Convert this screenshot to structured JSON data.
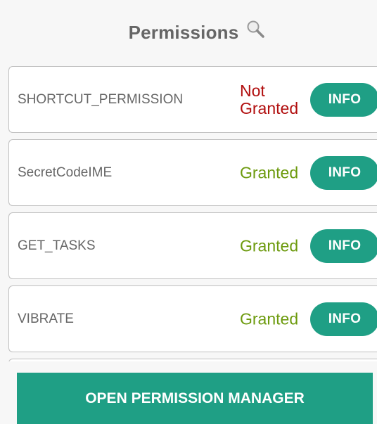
{
  "header": {
    "title": "Permissions",
    "search_icon": "search-icon"
  },
  "permissions": [
    {
      "name": "SHORTCUT_PERMISSION",
      "status": "Not Granted",
      "status_color": "#b10e0e",
      "button_label": "INFO"
    },
    {
      "name": "SecretCodeIME",
      "status": "Granted",
      "status_color": "#6c9a0d",
      "button_label": "INFO"
    },
    {
      "name": "GET_TASKS",
      "status": "Granted",
      "status_color": "#6c9a0d",
      "button_label": "INFO"
    },
    {
      "name": "VIBRATE",
      "status": "Granted",
      "status_color": "#6c9a0d",
      "button_label": "INFO"
    }
  ],
  "footer": {
    "button_label": "OPEN PERMISSION MANAGER"
  },
  "colors": {
    "accent": "#1f9f85",
    "background": "#f7f7f7",
    "granted": "#6c9a0d",
    "not_granted": "#b10e0e"
  }
}
